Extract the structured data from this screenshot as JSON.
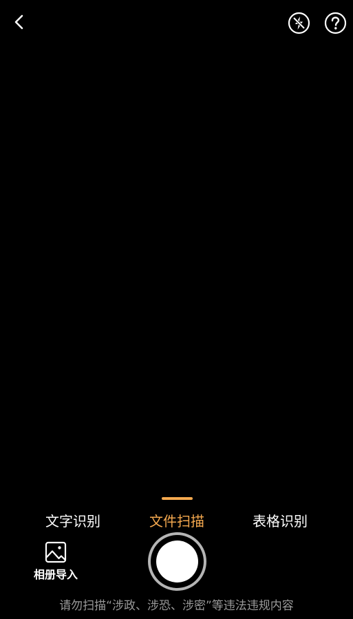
{
  "top_bar": {
    "back_icon": "chevron-left-icon",
    "flash_icon": "flash-off-icon",
    "help_icon": "help-circle-icon"
  },
  "modes": {
    "tabs": [
      {
        "label": "文字识别",
        "selected": false
      },
      {
        "label": "文件扫描",
        "selected": true
      },
      {
        "label": "表格识别",
        "selected": false
      }
    ]
  },
  "bottom": {
    "album_label": "相册导入",
    "album_icon": "image-icon",
    "shutter_icon": "shutter-button-icon",
    "warning": "请勿扫描“涉政、涉恐、涉密”等违法违规内容"
  },
  "colors": {
    "background": "#000000",
    "text": "#ffffff",
    "accent": "#f5a94f",
    "muted_text": "#9a9a9a"
  }
}
